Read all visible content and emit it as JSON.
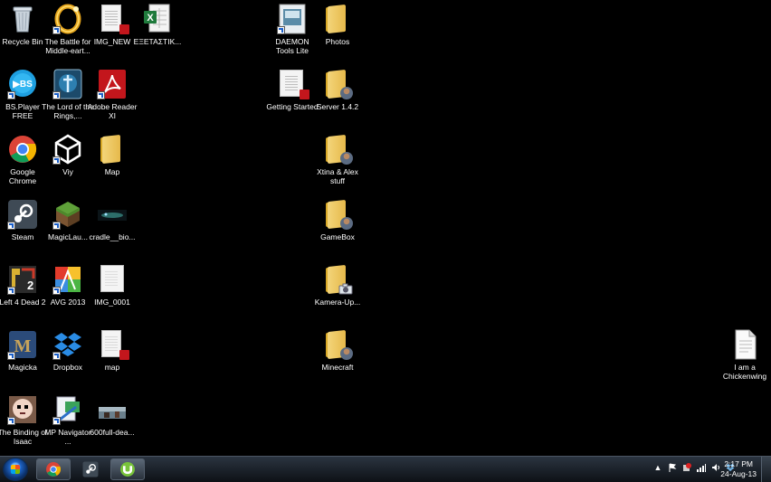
{
  "desktop": {
    "icons": {
      "recycle_bin": "Recycle Bin",
      "battle_middle_earth": "The Battle for Middle-eart...",
      "img_new": "IMG_NEW",
      "exetastik": "ΕΞΕΤΑΣΤΙΚ...",
      "daemon_tools": "DAEMON Tools Lite",
      "photos": "Photos",
      "bsplayer": "BS.Player FREE",
      "lord_of_rings": "The Lord of the Rings,...",
      "adobe_reader": "Adobe Reader XI",
      "getting_started": "Getting Started",
      "server": "Server 1.4.2",
      "google_chrome": "Google Chrome",
      "viy": "Viy",
      "map_folder": "Map",
      "xtina_alex": "Xtina & Alex stuff",
      "steam": "Steam",
      "magiclauncher": "MagicLau...",
      "cradle_bio": "cradle__bio...",
      "gamebox": "GameBox",
      "left4dead2": "Left 4 Dead 2",
      "avg2013": "AVG 2013",
      "img_0001": "IMG_0001",
      "kamera_up": "Kamera-Up...",
      "magicka": "Magicka",
      "dropbox": "Dropbox",
      "map_pdf": "map",
      "minecraft": "Minecraft",
      "chickenwing": "I am a Chickenwing",
      "binding_of_isaac": "The Binding of Isaac",
      "mp_navigator": "MP Navigator ...",
      "full_dea": "600full-dea..."
    }
  },
  "taskbar": {
    "clock_time": "2:17 PM",
    "clock_date": "24-Aug-13",
    "tray_overflow": "▲"
  },
  "colors": {
    "desktop_bg": "#000000",
    "taskbar_bg": "#1b222b"
  }
}
